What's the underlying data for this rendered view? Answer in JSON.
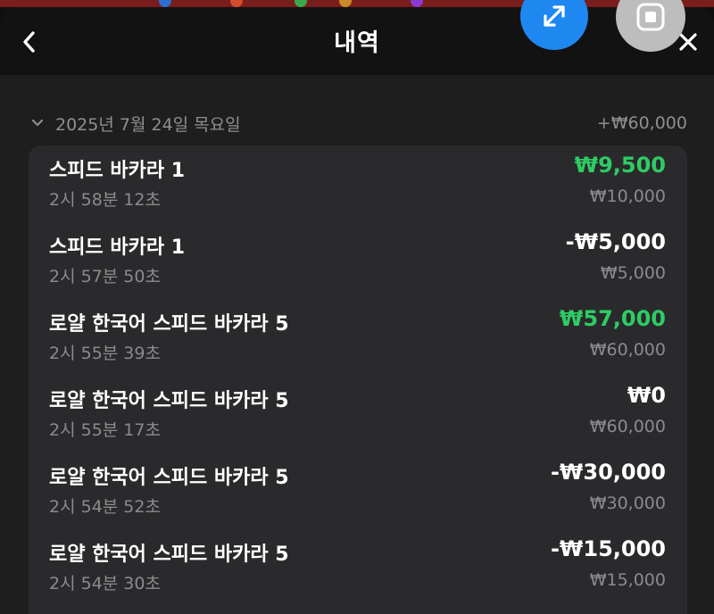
{
  "header": {
    "title": "내역",
    "back_icon": "chevron-left-icon",
    "close_icon": "close-icon",
    "expand_icon": "expand-arrows-icon",
    "stop_icon": "stop-square-icon",
    "expand_color": "#1e88f0",
    "stop_color": "#bdbdbd"
  },
  "date_group": {
    "date": "2025년 7월 24일 목요일",
    "total": "+₩60,000",
    "expanded": true
  },
  "history": [
    {
      "name": "스피드 바카라 1",
      "time": "2시 58분 12초",
      "amount": "₩9,500",
      "bet": "₩10,000",
      "result": "win"
    },
    {
      "name": "스피드 바카라 1",
      "time": "2시 57분 50초",
      "amount": "-₩5,000",
      "bet": "₩5,000",
      "result": "loss"
    },
    {
      "name": "로얄 한국어 스피드 바카라 5",
      "time": "2시 55분 39초",
      "amount": "₩57,000",
      "bet": "₩60,000",
      "result": "win"
    },
    {
      "name": "로얄 한국어 스피드 바카라 5",
      "time": "2시 55분 17초",
      "amount": "₩0",
      "bet": "₩60,000",
      "result": "push"
    },
    {
      "name": "로얄 한국어 스피드 바카라 5",
      "time": "2시 54분 52초",
      "amount": "-₩30,000",
      "bet": "₩30,000",
      "result": "loss"
    },
    {
      "name": "로얄 한국어 스피드 바카라 5",
      "time": "2시 54분 30초",
      "amount": "-₩15,000",
      "bet": "₩15,000",
      "result": "loss"
    }
  ],
  "colors": {
    "win": "#2ecc64",
    "neutral": "#ffffff",
    "muted": "#8b8b8e",
    "card": "#2a2a2c",
    "background": "#1e1e1f"
  }
}
